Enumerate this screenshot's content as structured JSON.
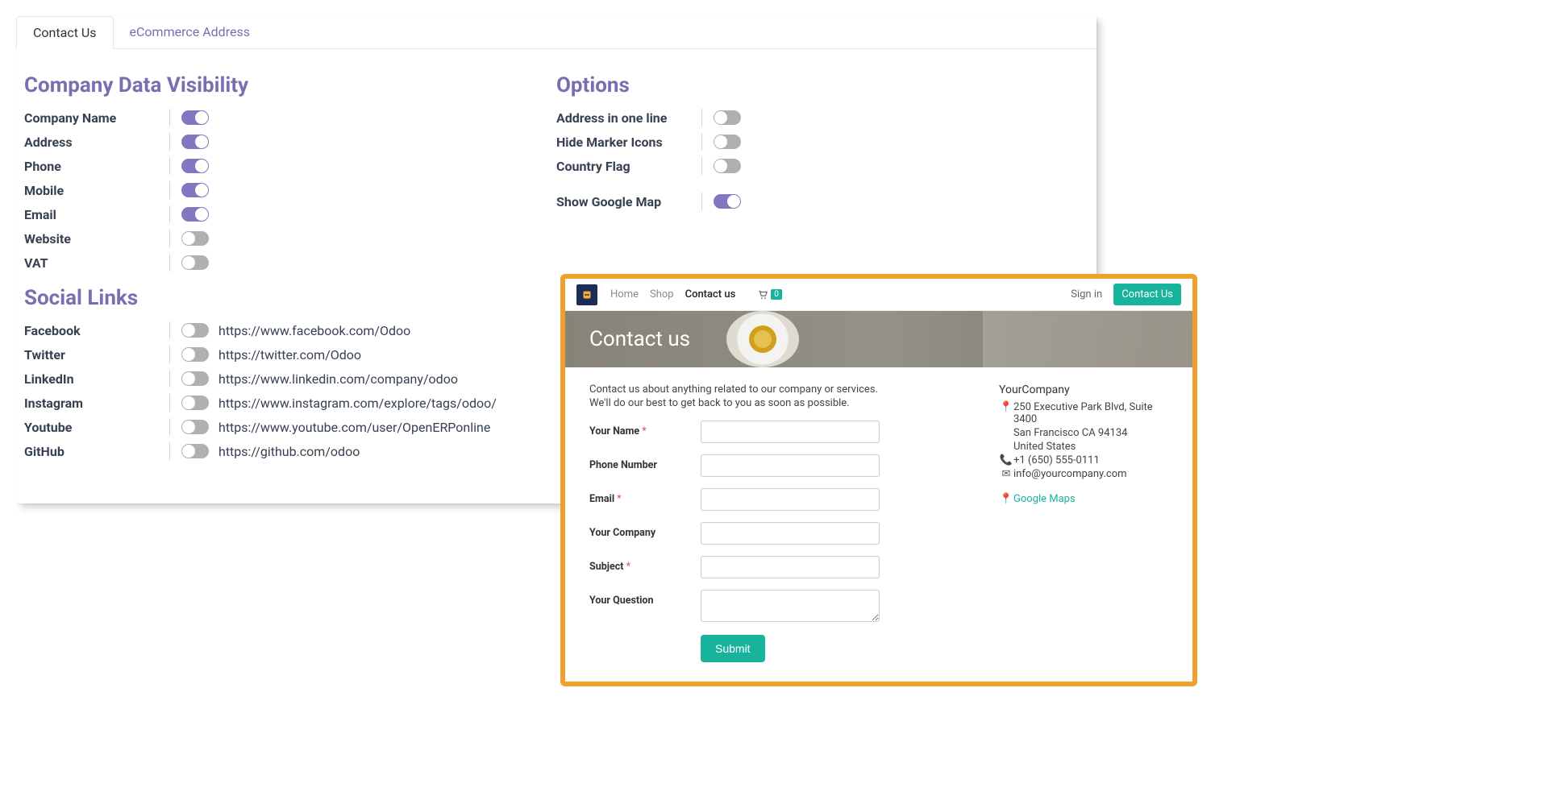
{
  "tabs": {
    "contact": "Contact Us",
    "ecommerce": "eCommerce Address"
  },
  "sections": {
    "visibility_title": "Company Data Visibility",
    "social_title": "Social Links",
    "options_title": "Options"
  },
  "visibility": [
    {
      "label": "Company Name",
      "on": true
    },
    {
      "label": "Address",
      "on": true
    },
    {
      "label": "Phone",
      "on": true
    },
    {
      "label": "Mobile",
      "on": true
    },
    {
      "label": "Email",
      "on": true
    },
    {
      "label": "Website",
      "on": false
    },
    {
      "label": "VAT",
      "on": false
    }
  ],
  "social": [
    {
      "label": "Facebook",
      "on": false,
      "url": "https://www.facebook.com/Odoo"
    },
    {
      "label": "Twitter",
      "on": false,
      "url": "https://twitter.com/Odoo"
    },
    {
      "label": "LinkedIn",
      "on": false,
      "url": "https://www.linkedin.com/company/odoo"
    },
    {
      "label": "Instagram",
      "on": false,
      "url": "https://www.instagram.com/explore/tags/odoo/"
    },
    {
      "label": "Youtube",
      "on": false,
      "url": "https://www.youtube.com/user/OpenERPonline"
    },
    {
      "label": "GitHub",
      "on": false,
      "url": "https://github.com/odoo"
    }
  ],
  "options": [
    {
      "label": "Address in one line",
      "on": false
    },
    {
      "label": "Hide Marker Icons",
      "on": false
    },
    {
      "label": "Country Flag",
      "on": false
    }
  ],
  "gmap": {
    "label": "Show Google Map",
    "on": true
  },
  "preview": {
    "nav": {
      "home": "Home",
      "shop": "Shop",
      "contact": "Contact us",
      "cart_count": "0",
      "signin": "Sign in",
      "cta": "Contact Us"
    },
    "hero_title": "Contact us",
    "intro1": "Contact us about anything related to our company or services.",
    "intro2": "We'll do our best to get back to you as soon as possible.",
    "form": {
      "name": "Your Name",
      "phone": "Phone Number",
      "email": "Email",
      "company": "Your Company",
      "subject": "Subject",
      "question": "Your Question",
      "submit": "Submit",
      "star": "*"
    },
    "company": {
      "name": "YourCompany",
      "addr1": "250 Executive Park Blvd, Suite 3400",
      "addr2": "San Francisco CA 94134",
      "addr3": "United States",
      "phone": "+1 (650) 555-0111",
      "email": "info@yourcompany.com",
      "gmaps": "Google Maps"
    }
  }
}
